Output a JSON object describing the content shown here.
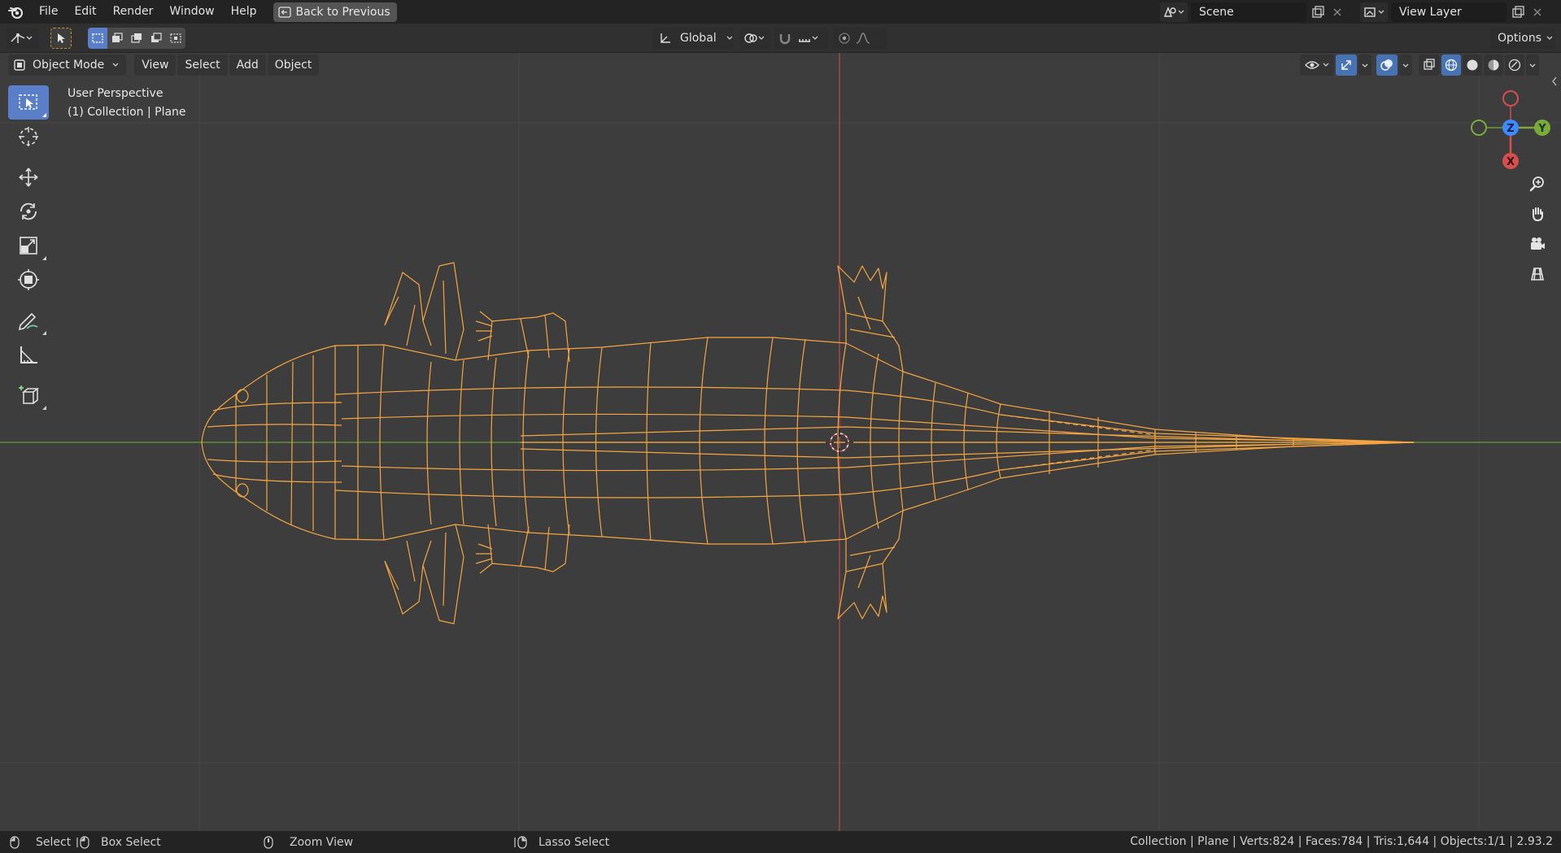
{
  "topbar": {
    "menu": [
      "File",
      "Edit",
      "Render",
      "Window",
      "Help"
    ],
    "back_button": "Back to Previous",
    "scene_name": "Scene",
    "view_layer_name": "View Layer"
  },
  "header": {
    "transform_orientation": "Global",
    "options_label": "Options"
  },
  "viewport": {
    "mode": "Object Mode",
    "menus": [
      "View",
      "Select",
      "Add",
      "Object"
    ],
    "perspective_label": "User Perspective",
    "collection_label": "(1) Collection | Plane",
    "gizmo_axes": {
      "z": "Z",
      "y": "Y",
      "x": "X"
    }
  },
  "colors": {
    "wire": "#f5a541",
    "x_axis": "#d64e4e",
    "y_axis": "#7aaa3a",
    "z_axis": "#3d8bff",
    "accent": "#5a7ec8"
  },
  "statusbar": {
    "select": "Select",
    "box_select": "Box Select",
    "zoom_view": "Zoom View",
    "lasso_select": "Lasso Select",
    "stats": "Collection | Plane | Verts:824 | Faces:784 | Tris:1,644 | Objects:1/1 | 2.93.2"
  }
}
